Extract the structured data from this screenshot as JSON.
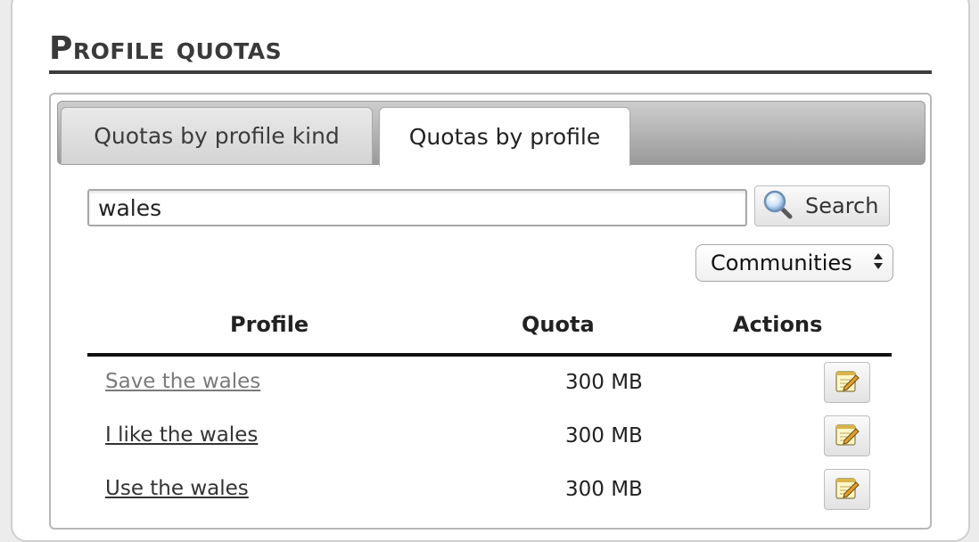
{
  "page": {
    "title": "Profile quotas"
  },
  "tabs": [
    {
      "label": "Quotas by profile kind",
      "active": false
    },
    {
      "label": "Quotas by profile",
      "active": true
    }
  ],
  "search": {
    "value": "wales",
    "button_label": "Search",
    "icon": "magnifier-icon"
  },
  "filter": {
    "selected": "Communities"
  },
  "table": {
    "columns": [
      "Profile",
      "Quota",
      "Actions"
    ],
    "rows": [
      {
        "profile": "Save the wales",
        "quota": "300 MB",
        "action_icon": "edit-icon",
        "visited": true
      },
      {
        "profile": "I like the wales",
        "quota": "300 MB",
        "action_icon": "edit-icon",
        "visited": false
      },
      {
        "profile": "Use the wales",
        "quota": "300 MB",
        "action_icon": "edit-icon",
        "visited": false
      }
    ]
  },
  "colors": {
    "link": "#333333",
    "link_visited": "#7a7a7a",
    "title": "#3a3a3a"
  }
}
